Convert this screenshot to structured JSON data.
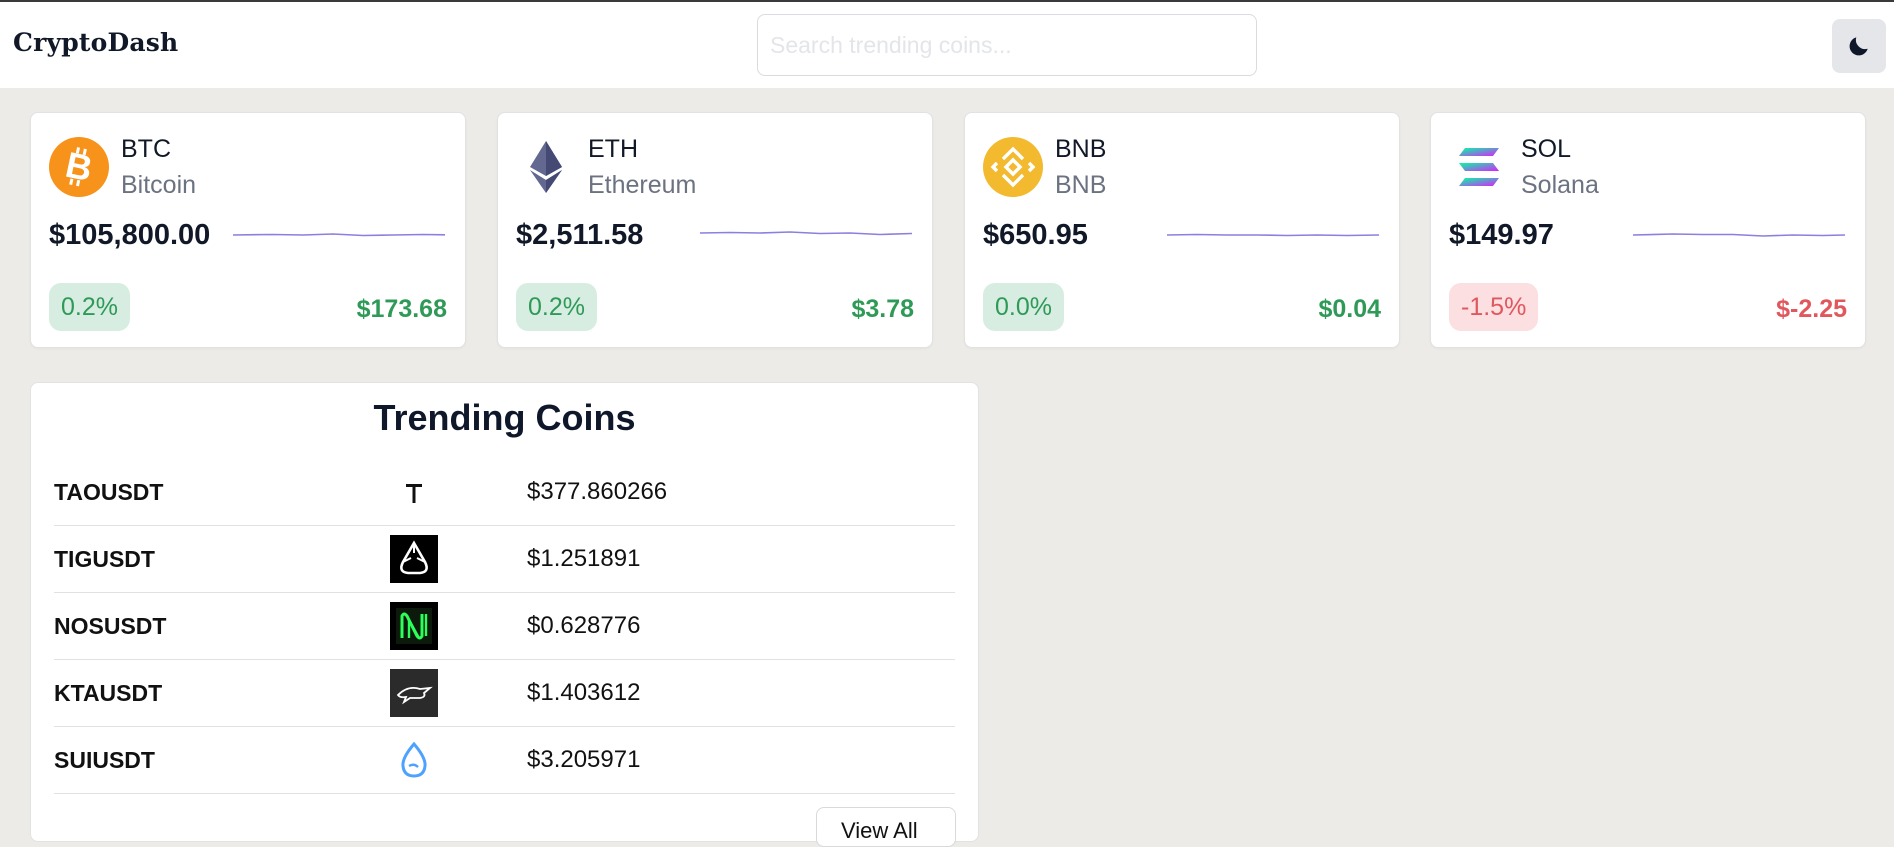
{
  "app": {
    "title": "CryptoDash"
  },
  "search": {
    "placeholder": "Search trending coins..."
  },
  "cards": [
    {
      "symbol": "BTC",
      "name": "Bitcoin",
      "price": "$105,800.00",
      "change_pct": "0.2%",
      "change_usd": "$173.68",
      "trend": "up",
      "icon": "bitcoin-icon",
      "color": "#f7931a"
    },
    {
      "symbol": "ETH",
      "name": "Ethereum",
      "price": "$2,511.58",
      "change_pct": "0.2%",
      "change_usd": "$3.78",
      "trend": "up",
      "icon": "ethereum-icon",
      "color": "#62688f"
    },
    {
      "symbol": "BNB",
      "name": "BNB",
      "price": "$650.95",
      "change_pct": "0.0%",
      "change_usd": "$0.04",
      "trend": "up",
      "icon": "bnb-icon",
      "color": "#f3ba2f"
    },
    {
      "symbol": "SOL",
      "name": "Solana",
      "price": "$149.97",
      "change_pct": "-1.5%",
      "change_usd": "$-2.25",
      "trend": "down",
      "icon": "solana-icon",
      "color": "#9945ff"
    }
  ],
  "trending": {
    "title": "Trending Coins",
    "rows": [
      {
        "pair": "TAOUSDT",
        "price": "$377.860266",
        "icon": "bittensor-icon"
      },
      {
        "pair": "TIGUSDT",
        "price": "$1.251891",
        "icon": "tig-icon"
      },
      {
        "pair": "NOSUSDT",
        "price": "$0.628776",
        "icon": "nosana-icon"
      },
      {
        "pair": "KTAUSDT",
        "price": "$1.403612",
        "icon": "keeta-icon"
      },
      {
        "pair": "SUIUSDT",
        "price": "$3.205971",
        "icon": "sui-icon"
      }
    ],
    "view_all_label": "View All"
  },
  "colors": {
    "positive": "#2f9a58",
    "negative": "#e0575e",
    "sparkline": "#8b7fe0",
    "background": "#edebe7"
  }
}
